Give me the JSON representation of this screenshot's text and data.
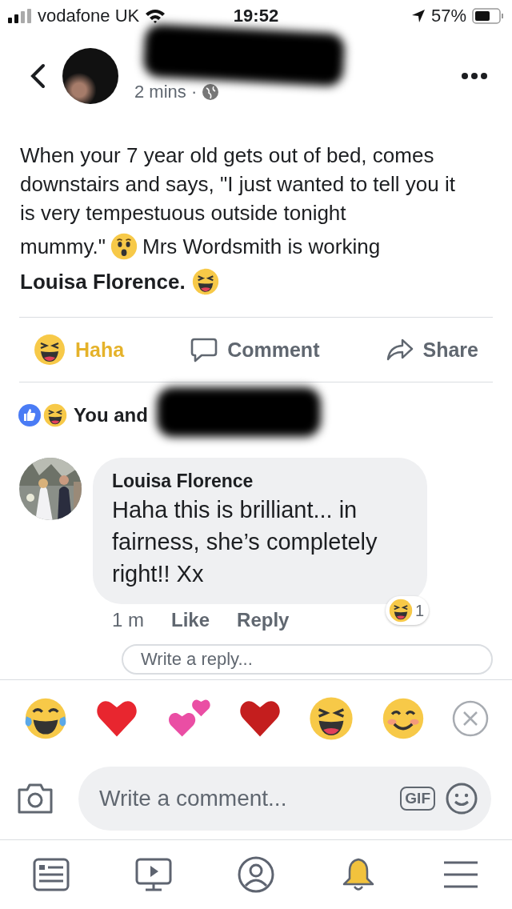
{
  "status_bar": {
    "carrier": "vodafone UK",
    "time": "19:52",
    "battery": "57%"
  },
  "header": {
    "timestamp": "2 mins ·"
  },
  "post": {
    "text_before": "When your 7 year old gets out of bed, comes downstairs and says, \"I just wanted to tell you it is very tempestuous outside tonight",
    "text_quote_end": "mummy.\"",
    "text_after": "Mrs Wordsmith is working",
    "mention": "Louisa Florence."
  },
  "actions": [
    {
      "kind": "haha",
      "label": "Haha",
      "selected": true
    },
    {
      "kind": "comment",
      "label": "Comment",
      "selected": false
    },
    {
      "kind": "share",
      "label": "Share",
      "selected": false
    }
  ],
  "reactions_summary": {
    "text": "You and"
  },
  "comment": {
    "author": "Louisa Florence",
    "text": "Haha this is brilliant... in fairness, she’s completely right!! Xx",
    "time": "1 m",
    "like": "Like",
    "reply": "Reply",
    "reaction_count": "1"
  },
  "reply_field": {
    "placeholder": "Write a reply..."
  },
  "composer": {
    "placeholder": "Write a comment...",
    "gif": "GIF"
  },
  "tabs": [
    {
      "kind": "feed",
      "selected": false
    },
    {
      "kind": "video",
      "selected": false
    },
    {
      "kind": "profile",
      "selected": false
    },
    {
      "kind": "notifications",
      "selected": true
    },
    {
      "kind": "menu",
      "selected": false
    }
  ]
}
